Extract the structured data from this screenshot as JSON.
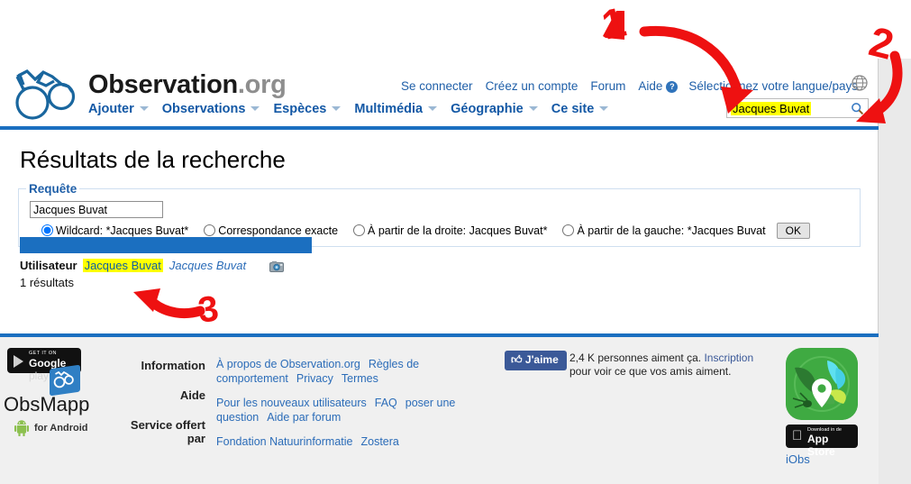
{
  "header": {
    "brand_name": "Observation",
    "brand_tld": ".org",
    "logo_icon": "binoculars-icon",
    "globe_icon": "globe-icon",
    "top_links": [
      {
        "label": "Se connecter"
      },
      {
        "label": "Créez un compte"
      },
      {
        "label": "Forum"
      },
      {
        "label": "Aide"
      },
      {
        "label": "Sélectionnez votre langue/pays"
      }
    ],
    "help_badge": "?",
    "nav_items": [
      {
        "label": "Ajouter"
      },
      {
        "label": "Observations"
      },
      {
        "label": "Espèces"
      },
      {
        "label": "Multimédia"
      },
      {
        "label": "Géographie"
      },
      {
        "label": "Ce site"
      }
    ],
    "search": {
      "value": "Jacques Buvat",
      "placeholder": "",
      "icon": "magnifier-icon",
      "highlight_color": "#ffff00"
    }
  },
  "main": {
    "page_title": "Résultats de la recherche",
    "query_legend": "Requête",
    "query_value": "Jacques Buvat",
    "radio_options": [
      {
        "label": "Wildcard: *Jacques Buvat*",
        "checked": true
      },
      {
        "label": "Correspondance exacte",
        "checked": false
      },
      {
        "label": "À partir de la droite: Jacques Buvat*",
        "checked": false
      },
      {
        "label": "À partir de la gauche: *Jacques Buvat",
        "checked": false
      }
    ],
    "ok_label": "OK",
    "result": {
      "kind": "Utilisateur",
      "name_highlighted": "Jacques Buvat",
      "name_italic": "Jacques Buvat",
      "camera_icon": "camera-icon"
    },
    "result_count": "1 résultats"
  },
  "footer": {
    "google_play": {
      "small": "GET IT ON",
      "big_bold": "Google",
      "big_light": " play"
    },
    "obsmapp": {
      "title": "ObsMapp",
      "subtitle": "for Android",
      "android_icon": "android-icon"
    },
    "labels": [
      "Information",
      "Aide",
      "Service offert par"
    ],
    "link_groups": [
      {
        "links": [
          "À propos de Observation.org",
          "Règles de comportement",
          "Privacy",
          "Termes"
        ]
      },
      {
        "links": [
          "Pour les nouveaux utilisateurs",
          "FAQ",
          "poser une question",
          "Aide par forum"
        ]
      },
      {
        "links": [
          "Fondation Natuurinformatie",
          "Zostera"
        ]
      }
    ],
    "facebook": {
      "button_label": "J'aime",
      "thumb_icon": "thumbs-up-icon",
      "text_before": "2,4 K personnes aiment ça.",
      "link": "Inscription",
      "text_after": "pour voir ce que vos amis aiment."
    },
    "iobs": {
      "app_icon": "iobs-app-icon",
      "appstore_small": "Download in de",
      "appstore_big": "App Store",
      "apple_icon": "apple-icon",
      "label": "iObs"
    }
  },
  "annotations": {
    "color": "#ee1111",
    "marks": [
      {
        "label": "1",
        "target": "search-input"
      },
      {
        "label": "2",
        "target": "search-magnifier"
      },
      {
        "label": "3",
        "target": "result-user-link"
      }
    ]
  }
}
